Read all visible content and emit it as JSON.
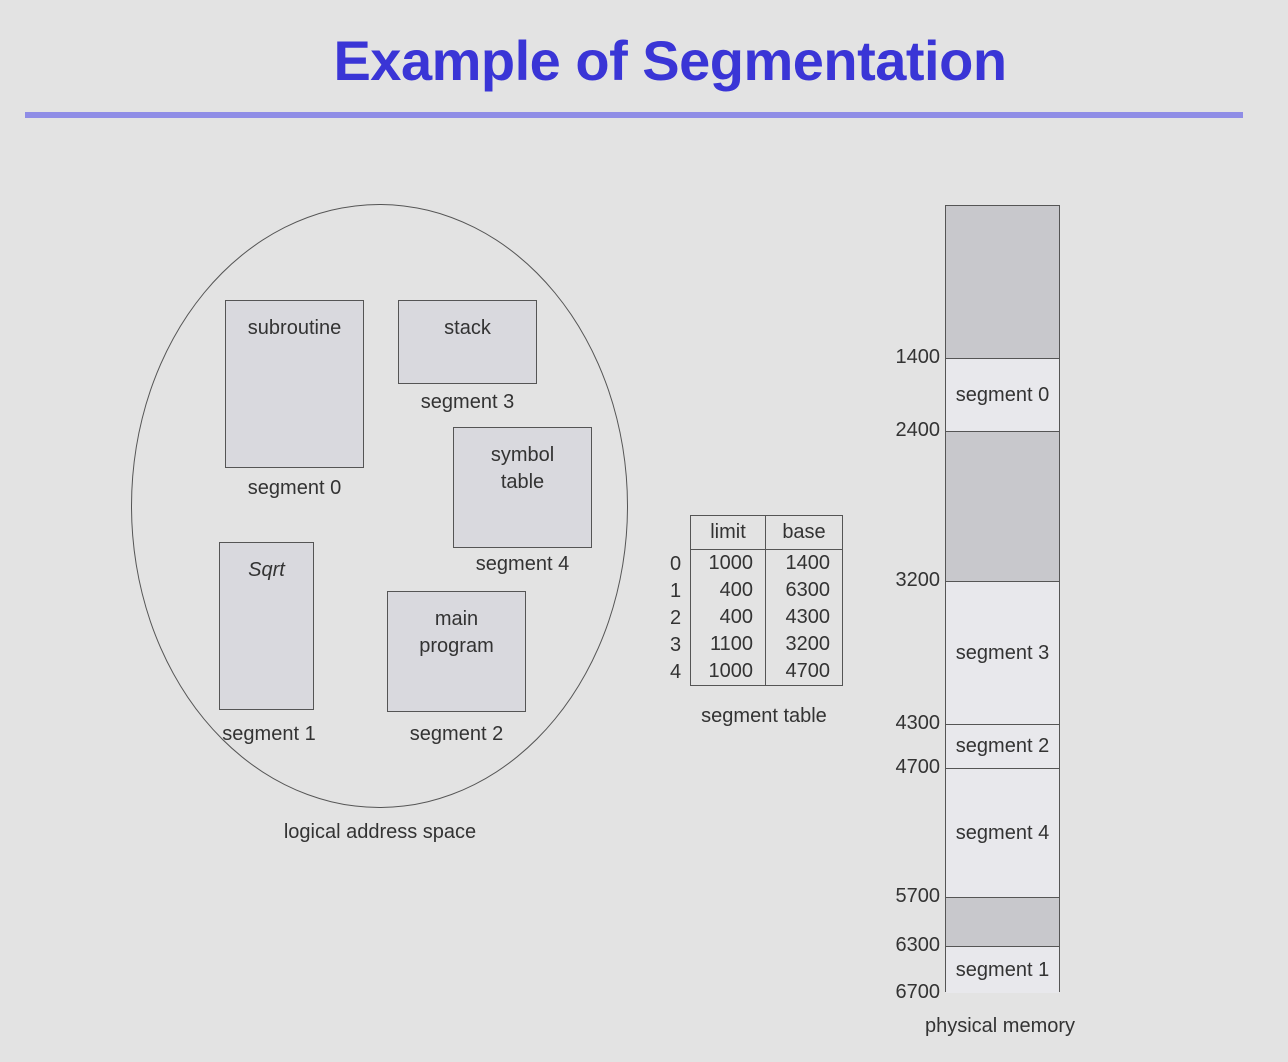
{
  "title": "Example of Segmentation",
  "logical": {
    "caption": "logical address space",
    "segments": [
      {
        "text": "subroutine",
        "caption": "segment 0"
      },
      {
        "text": "stack",
        "caption": "segment 3"
      },
      {
        "text": "symbol\ntable",
        "caption": "segment 4"
      },
      {
        "text": "Sqrt",
        "caption": "segment 1"
      },
      {
        "text": "main\nprogram",
        "caption": "segment 2"
      }
    ]
  },
  "segment_table": {
    "caption": "segment table",
    "headers": [
      "limit",
      "base"
    ],
    "rows": [
      {
        "index": "0",
        "limit": "1000",
        "base": "1400"
      },
      {
        "index": "1",
        "limit": "400",
        "base": "6300"
      },
      {
        "index": "2",
        "limit": "400",
        "base": "4300"
      },
      {
        "index": "3",
        "limit": "1100",
        "base": "3200"
      },
      {
        "index": "4",
        "limit": "1000",
        "base": "4700"
      }
    ]
  },
  "physical": {
    "caption": "physical memory",
    "addresses": [
      "1400",
      "2400",
      "3200",
      "4300",
      "4700",
      "5700",
      "6300",
      "6700"
    ],
    "blocks": [
      {
        "label": "",
        "start": 0,
        "end": 1400,
        "used": false
      },
      {
        "label": "segment 0",
        "start": 1400,
        "end": 2400,
        "used": true
      },
      {
        "label": "",
        "start": 2400,
        "end": 3200,
        "used": false
      },
      {
        "label": "segment 3",
        "start": 3200,
        "end": 4300,
        "used": true
      },
      {
        "label": "segment 2",
        "start": 4300,
        "end": 4700,
        "used": true
      },
      {
        "label": "segment 4",
        "start": 4700,
        "end": 5700,
        "used": true
      },
      {
        "label": "",
        "start": 5700,
        "end": 6300,
        "used": false
      },
      {
        "label": "segment 1",
        "start": 6300,
        "end": 6700,
        "used": true
      }
    ]
  }
}
